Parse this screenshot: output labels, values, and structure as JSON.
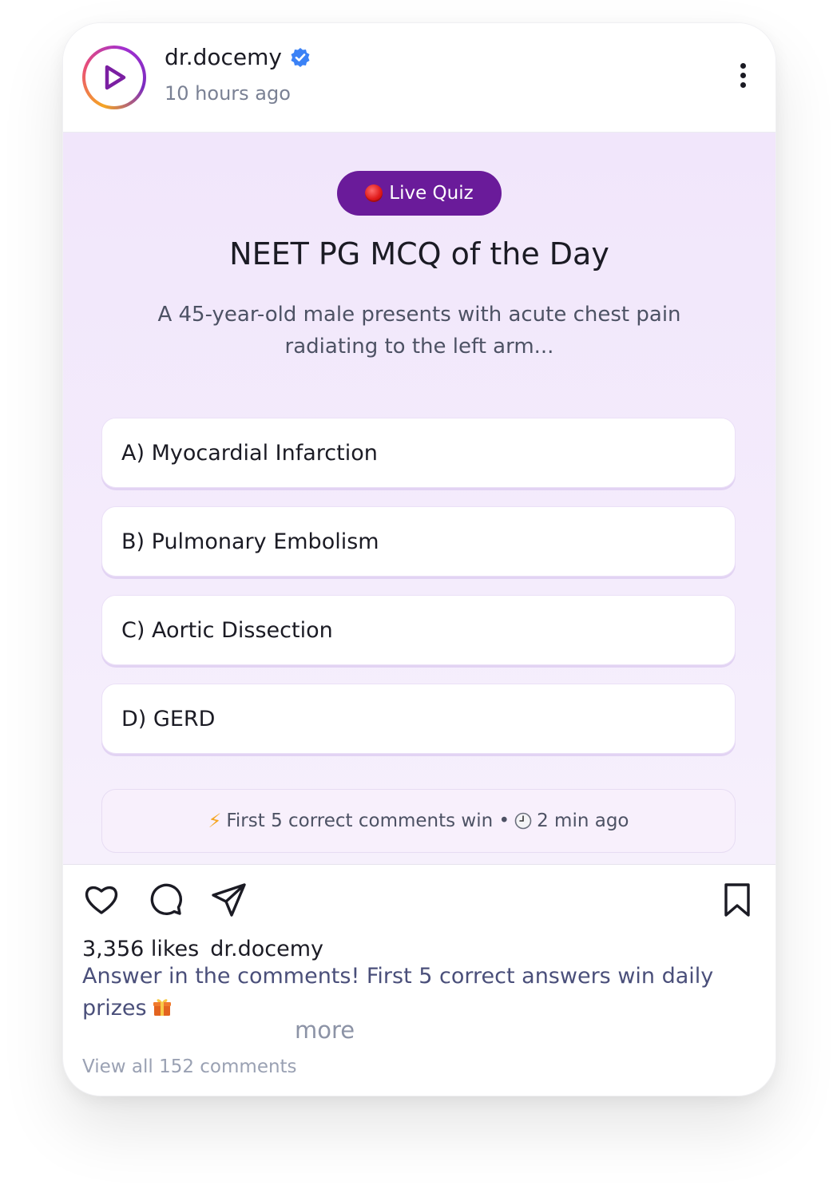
{
  "post": {
    "username": "dr.docemy",
    "timestamp": "10 hours ago"
  },
  "quiz": {
    "badge_label": "Live Quiz",
    "title": "NEET PG MCQ of the Day",
    "question": "A 45-year-old male presents with acute chest pain radiating to the left arm...",
    "options": [
      {
        "label": "A) Myocardial Infarction"
      },
      {
        "label": "B) Pulmonary Embolism"
      },
      {
        "label": "C) Aortic Dissection"
      },
      {
        "label": "D) GERD"
      }
    ],
    "info_text": "First 5 correct comments win •",
    "info_time": "2 min ago"
  },
  "footer": {
    "likes": "3,356 likes",
    "caption_user": "dr.docemy",
    "caption": "Answer in the comments! First 5 correct answers win daily prizes",
    "more_label": "more",
    "view_comments": "View all 152 comments"
  },
  "icons": {
    "avatar": "play-icon",
    "verified": "verified-badge-icon",
    "menu": "more-vertical-icon",
    "like": "heart-icon",
    "comment": "comment-icon",
    "share": "send-icon",
    "save": "bookmark-icon"
  },
  "colors": {
    "accent": "#6a1b9a",
    "verified": "#3b82f6",
    "quiz_bg": "#f3eafc",
    "caption_text": "#4a4f7a"
  }
}
